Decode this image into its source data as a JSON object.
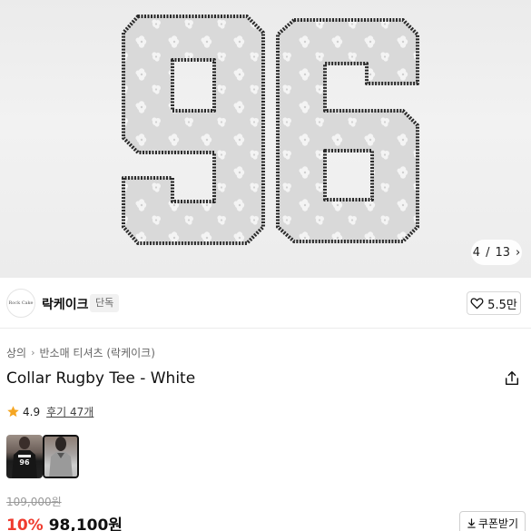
{
  "gallery": {
    "image_alt": "96",
    "counter_current": "4",
    "counter_sep": "/",
    "counter_total": "13"
  },
  "brand": {
    "logo_text": "Rock Cake",
    "name": "락케이크",
    "badge": "단독",
    "likes": "5.5만"
  },
  "breadcrumb": {
    "items": [
      "상의",
      "반소매 티셔츠 (락케이크)"
    ]
  },
  "product": {
    "title": "Collar Rugby Tee - White",
    "rating": "4.9",
    "reviews": "후기 47개",
    "original_price": "109,000원",
    "discount": "10%",
    "price": "98,100원",
    "coupon_label": "쿠폰받기"
  },
  "colors": {
    "discount": "#ef3b2e",
    "star": "#f5a623"
  }
}
